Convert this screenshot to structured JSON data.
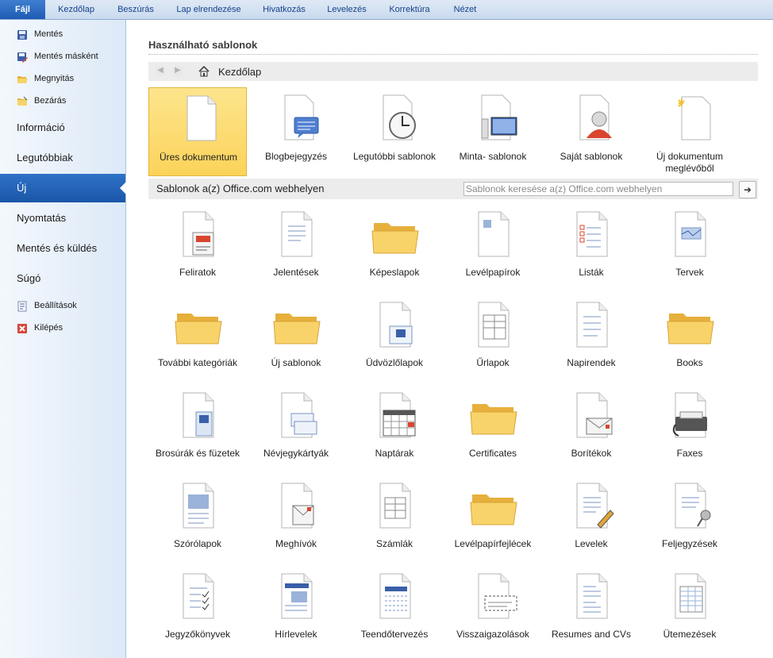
{
  "ribbon": {
    "tabs": [
      "Fájl",
      "Kezdőlap",
      "Beszúrás",
      "Lap elrendezése",
      "Hivatkozás",
      "Levelezés",
      "Korrektúra",
      "Nézet"
    ]
  },
  "nav": {
    "commands_top": [
      {
        "label": "Mentés",
        "icon": "save-icon"
      },
      {
        "label": "Mentés másként",
        "icon": "save-as-icon"
      },
      {
        "label": "Megnyitás",
        "icon": "open-folder-icon"
      },
      {
        "label": "Bezárás",
        "icon": "close-folder-icon"
      }
    ],
    "sections": [
      "Információ",
      "Legutóbbiak",
      "Új",
      "Nyomtatás",
      "Mentés és küldés",
      "Súgó"
    ],
    "active_section": "Új",
    "commands_bottom": [
      {
        "label": "Beállítások",
        "icon": "options-icon"
      },
      {
        "label": "Kilépés",
        "icon": "exit-icon"
      }
    ]
  },
  "main": {
    "heading": "Használható sablonok",
    "breadcrumb": "Kezdőlap",
    "top_templates": [
      {
        "label": "Üres dokumentum",
        "icon": "blank-document-icon",
        "selected": true
      },
      {
        "label": "Blogbejegyzés",
        "icon": "blog-post-icon"
      },
      {
        "label": "Legutóbbi sablonok",
        "icon": "recent-templates-icon"
      },
      {
        "label": "Minta- sablonok",
        "icon": "sample-templates-icon"
      },
      {
        "label": "Saját sablonok",
        "icon": "my-templates-icon"
      },
      {
        "label": "Új dokumentum meglévőből",
        "icon": "new-from-existing-icon"
      }
    ],
    "office_bar_label": "Sablonok a(z) Office.com webhelyen",
    "search_placeholder": "Sablonok keresése a(z) Office.com webhelyen",
    "office_templates": [
      {
        "label": "Feliratok",
        "icon": "labels-icon"
      },
      {
        "label": "Jelentések",
        "icon": "reports-icon"
      },
      {
        "label": "Képeslapok",
        "icon": "folder-icon"
      },
      {
        "label": "Levélpapírok",
        "icon": "stationery-icon"
      },
      {
        "label": "Listák",
        "icon": "lists-icon"
      },
      {
        "label": "Tervek",
        "icon": "plans-icon"
      },
      {
        "label": "További kategóriák",
        "icon": "folder-icon"
      },
      {
        "label": "Új sablonok",
        "icon": "folder-icon"
      },
      {
        "label": "Üdvözlőlapok",
        "icon": "greeting-cards-icon"
      },
      {
        "label": "Űrlapok",
        "icon": "forms-icon"
      },
      {
        "label": "Napirendek",
        "icon": "agendas-icon"
      },
      {
        "label": "Books",
        "icon": "folder-icon"
      },
      {
        "label": "Brosúrák és füzetek",
        "icon": "brochures-icon"
      },
      {
        "label": "Névjegykártyák",
        "icon": "business-cards-icon"
      },
      {
        "label": "Naptárak",
        "icon": "calendar-icon"
      },
      {
        "label": "Certificates",
        "icon": "folder-icon"
      },
      {
        "label": "Borítékok",
        "icon": "envelope-icon"
      },
      {
        "label": "Faxes",
        "icon": "fax-icon"
      },
      {
        "label": "Szórólapok",
        "icon": "flyers-icon"
      },
      {
        "label": "Meghívók",
        "icon": "invitations-icon"
      },
      {
        "label": "Számlák",
        "icon": "invoices-icon"
      },
      {
        "label": "Levélpapírfejlécek",
        "icon": "folder-icon"
      },
      {
        "label": "Levelek",
        "icon": "letters-icon"
      },
      {
        "label": "Feljegyzések",
        "icon": "memos-icon"
      },
      {
        "label": "Jegyzőkönyvek",
        "icon": "minutes-icon"
      },
      {
        "label": "Hírlevelek",
        "icon": "newsletters-icon"
      },
      {
        "label": "Teendőtervezés",
        "icon": "planners-icon"
      },
      {
        "label": "Visszaigazolások",
        "icon": "receipts-icon"
      },
      {
        "label": "Resumes and CVs",
        "icon": "resumes-icon"
      },
      {
        "label": "Ütemezések",
        "icon": "schedules-icon"
      }
    ]
  },
  "colors": {
    "file_tab": "#1e5cb3",
    "active_nav": "#1a56a8",
    "selected_tile": "#fbd35a",
    "folder": "#f5c94d"
  }
}
